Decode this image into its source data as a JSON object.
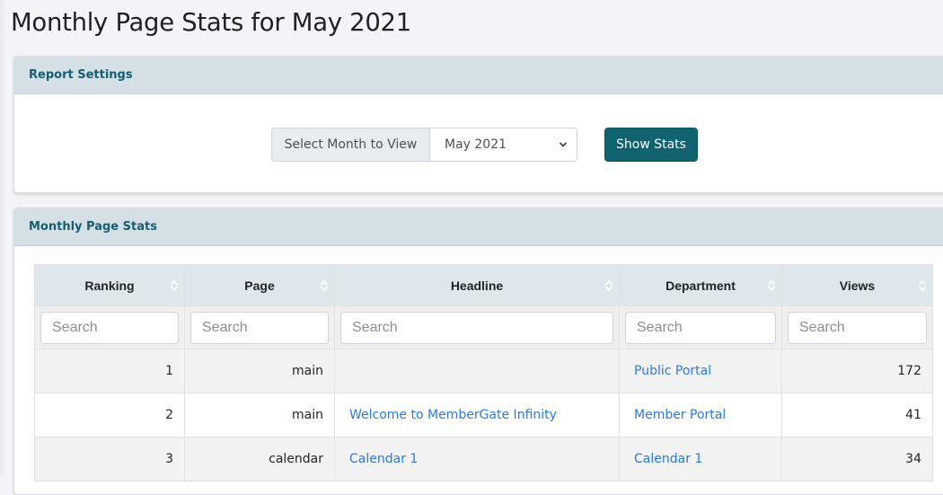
{
  "page": {
    "title": "Monthly Page Stats for May 2021"
  },
  "report_settings": {
    "header": "Report Settings",
    "select_label": "Select Month to View",
    "selected_month": "May 2021",
    "show_button": "Show Stats"
  },
  "stats": {
    "header": "Monthly Page Stats",
    "columns": [
      "Ranking",
      "Page",
      "Headline",
      "Department",
      "Views"
    ],
    "search_placeholder": "Search",
    "rows": [
      {
        "ranking": "1",
        "page": "main",
        "headline": "",
        "department": "Public Portal",
        "views": "172"
      },
      {
        "ranking": "2",
        "page": "main",
        "headline": "Welcome to MemberGate Infinity",
        "department": "Member Portal",
        "views": "41"
      },
      {
        "ranking": "3",
        "page": "calendar",
        "headline": "Calendar 1",
        "department": "Calendar 1",
        "views": "34"
      }
    ]
  },
  "colors": {
    "accent": "#10636f",
    "card_header_bg": "#d4e0e6",
    "card_header_text": "#155e6e",
    "link": "#2a7ae2"
  },
  "icons": {
    "sort": "sort-icon",
    "select_chevron": "chevron-down-icon"
  }
}
